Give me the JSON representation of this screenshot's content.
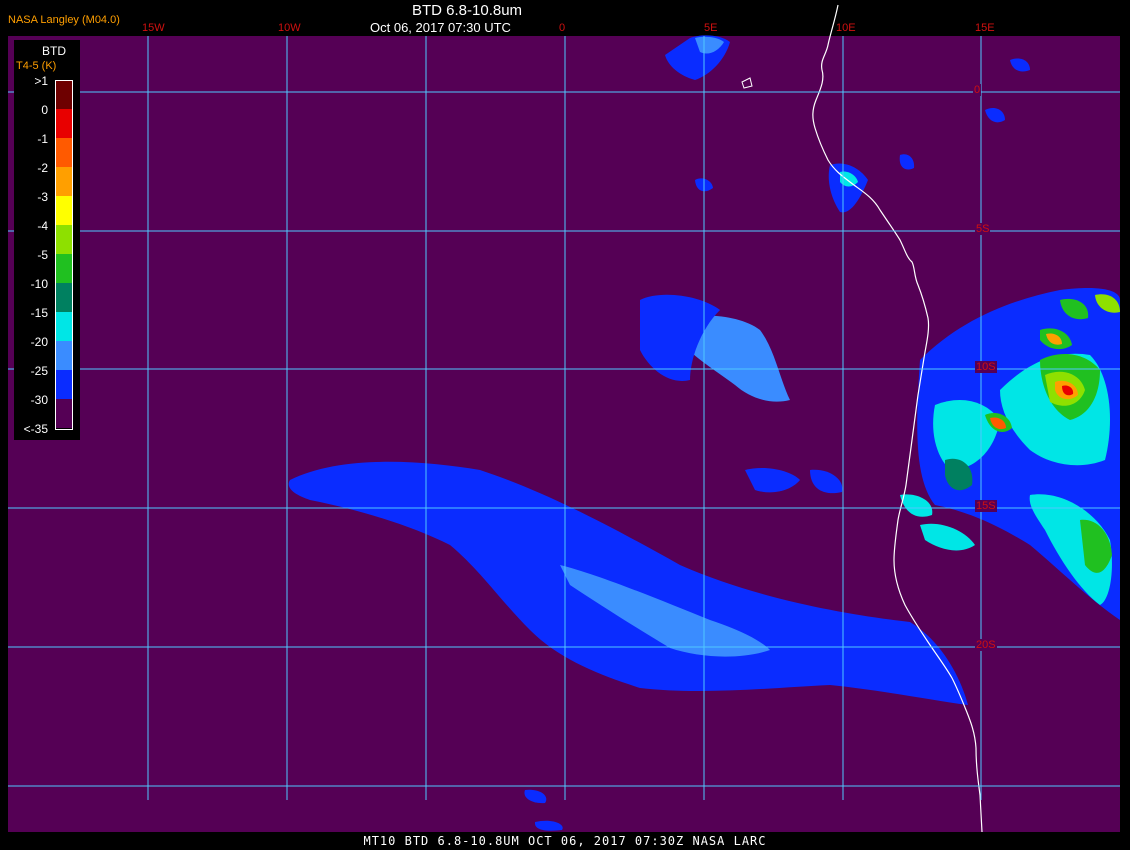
{
  "header": {
    "title": "BTD 6.8-10.8um",
    "datetime": "Oct 06, 2017 07:30 UTC",
    "credit": "NASA Langley (M04.0)"
  },
  "footer": {
    "text": "MT10  BTD 6.8-10.8UM   OCT 06, 2017 07:30Z   NASA LARC"
  },
  "grid": {
    "longitude_labels": [
      "15W",
      "10W",
      "0",
      "5E",
      "10E",
      "15E"
    ],
    "latitude_labels": [
      "0",
      "5S",
      "10S",
      "15S",
      "20S"
    ]
  },
  "legend": {
    "title": "BTD",
    "subtitle": "T4-5 (K)",
    "entries": [
      {
        "label": ">1",
        "color": "#6e0000"
      },
      {
        "label": "0",
        "color": "#e80000"
      },
      {
        "label": "-1",
        "color": "#ff5a00"
      },
      {
        "label": "-2",
        "color": "#ff9f00"
      },
      {
        "label": "-3",
        "color": "#ffff00"
      },
      {
        "label": "-4",
        "color": "#8ee000"
      },
      {
        "label": "-5",
        "color": "#20c020"
      },
      {
        "label": "-10",
        "color": "#008060"
      },
      {
        "label": "-15",
        "color": "#00e6e6"
      },
      {
        "label": "-20",
        "color": "#3a8cff"
      },
      {
        "label": "-25",
        "color": "#0a2cff"
      },
      {
        "label": "-30",
        "color": "#550055"
      },
      {
        "label": "<-35",
        "color": ""
      }
    ]
  },
  "colors": {
    "background": "#550055",
    "gridline": "#50c8ff",
    "coastline": "#ffffff",
    "grid_label": "#d01010"
  }
}
